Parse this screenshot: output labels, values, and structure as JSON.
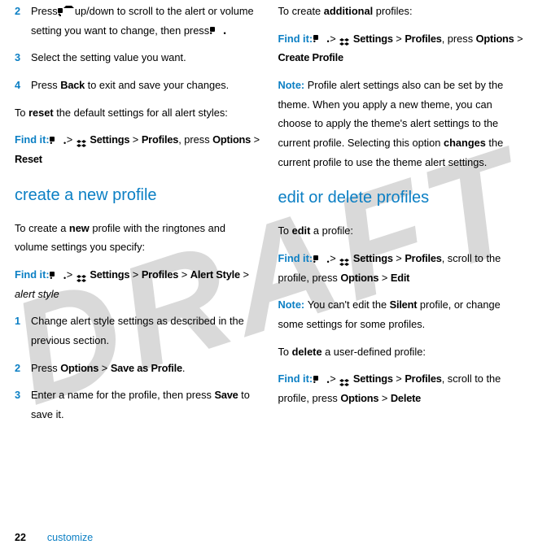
{
  "watermark": "DRAFT",
  "left": {
    "step2_num": "2",
    "step2_a": "Press ",
    "step2_b": " up/down to scroll to the alert or volume setting you want to change, then press ",
    "step2_c": ".",
    "step3_num": "3",
    "step3": "Select the setting value you want.",
    "step4_num": "4",
    "step4_a": "Press ",
    "step4_back": "Back",
    "step4_b": " to exit and save your changes.",
    "reset_a": "To ",
    "reset_bold": "reset",
    "reset_b": " the default settings for all alert styles:",
    "find_label": "Find it: ",
    "gt": " > ",
    "settings": "Settings",
    "profiles": "Profiles",
    "press": ", press ",
    "options": "Options",
    "reset": "Reset",
    "h2": "create a new profile",
    "newprof_a": "To create a ",
    "newprof_bold": "new",
    "newprof_b": " profile with the ringtones and volume settings you specify:",
    "alert_style": "Alert Style",
    "alert_style_it": "alert style",
    "s1_num": "1",
    "s1": "Change alert style settings as described in the previous section.",
    "s2_num": "2",
    "s2_a": "Press ",
    "save_as_profile": "Save as Profile",
    "s2_b": ".",
    "s3_num": "3",
    "s3_a": "Enter a name for the profile, then press ",
    "save": "Save",
    "s3_b": " to save it."
  },
  "right": {
    "add_a": "To create ",
    "add_bold": "additional",
    "add_b": " profiles:",
    "find_label": "Find it: ",
    "gt": " > ",
    "settings": "Settings",
    "profiles": "Profiles",
    "press": ", press ",
    "options": "Options",
    "create_profile": "Create Profile",
    "note_label": "Note: ",
    "note_a": "Profile alert settings also can be set by the theme. When you apply a new theme, you can choose to apply the theme's alert settings to the current profile. Selecting this option ",
    "changes": "changes",
    "note_b": " the current profile to use the theme alert settings.",
    "h2": "edit or delete profiles",
    "edit_a": "To ",
    "edit_bold": "edit",
    "edit_b": " a profile:",
    "scroll": ", scroll to the profile, press ",
    "edit": "Edit",
    "note2_a": "You can't edit the ",
    "silent": "Silent",
    "note2_b": " profile, or change some settings for some profiles.",
    "del_a": "To ",
    "del_bold": "delete",
    "del_b": " a user-defined profile:",
    "delete": "Delete"
  },
  "footer": {
    "page": "22",
    "label": "customize"
  }
}
